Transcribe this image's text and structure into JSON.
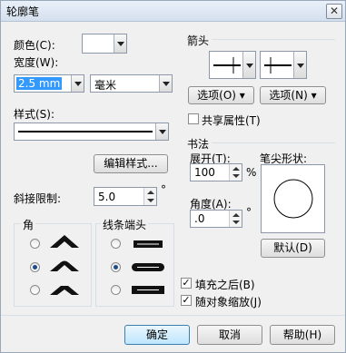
{
  "window": {
    "title": "轮廓笔",
    "close_glyph": "✕"
  },
  "left": {
    "color_label": "颜色(C):",
    "width_label": "宽度(W):",
    "width_value": "2.5 mm",
    "unit_value": "毫米",
    "style_label": "样式(S):",
    "edit_style_button": "编辑样式...",
    "miter_label": "斜接限制:",
    "miter_value": "5.0",
    "degree_symbol": "°"
  },
  "corners": {
    "title": "角",
    "selected_index": 1
  },
  "line_caps": {
    "title": "线条端头",
    "selected_index": 1
  },
  "arrows": {
    "title": "箭头",
    "options_left": "选项(O)",
    "options_right": "选项(N)",
    "share_attr_label": "共享属性(T)"
  },
  "calligraphy": {
    "title": "书法",
    "stretch_label": "展开(T):",
    "stretch_value": "100",
    "percent": "%",
    "angle_label": "角度(A):",
    "angle_value": ".0",
    "degree_symbol": "°",
    "nib_label": "笔尖形状:",
    "default_button": "默认(D)"
  },
  "options": {
    "fill_after_label": "填充之后(B)",
    "fill_after_checked": true,
    "scale_with_label": "随对象缩放(J)",
    "scale_with_checked": true
  },
  "footer": {
    "ok": "确定",
    "cancel": "取消",
    "help": "帮助(H)"
  }
}
